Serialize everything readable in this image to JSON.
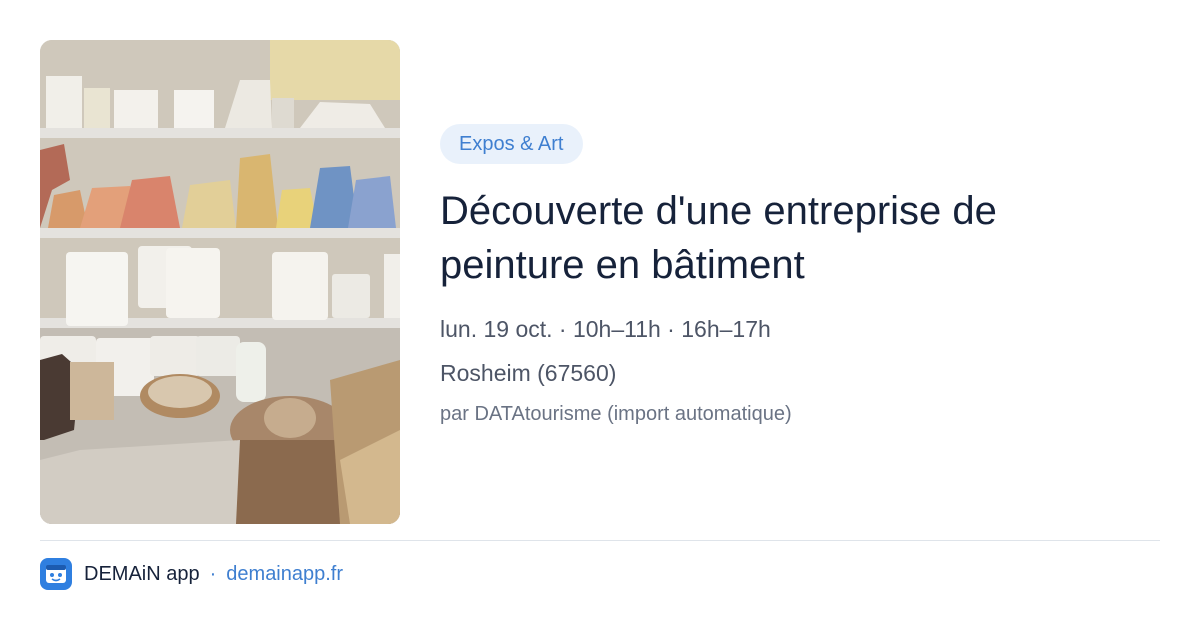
{
  "category": "Expos & Art",
  "event": {
    "title": "Découverte d'une entreprise de peinture en bâtiment",
    "schedule": "lun. 19 oct. · 10h–11h · 16h–17h",
    "location": "Rosheim (67560)",
    "author": "par DATAtourisme (import automatique)"
  },
  "footer": {
    "app_name": "DEMAiN app",
    "separator": "·",
    "site": "demainapp.fr"
  },
  "icons": {
    "logo": "demain-app-logo-icon"
  },
  "colors": {
    "accent": "#3f7fd0",
    "tag_background": "#e9f1fb",
    "title": "#16223a",
    "meta": "#4d5566",
    "logo_background": "#2f7fe0"
  }
}
